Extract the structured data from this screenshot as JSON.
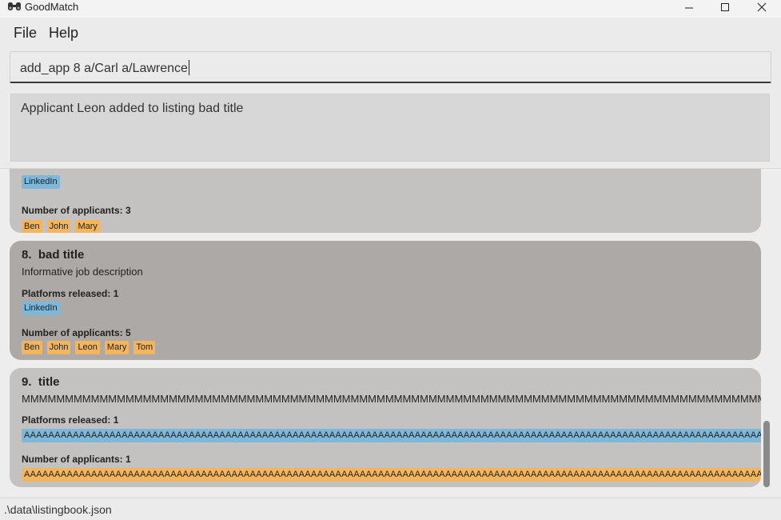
{
  "window": {
    "title": "GoodMatch",
    "icon": "binoculars-icon",
    "controls": [
      "minimize-icon",
      "maximize-icon",
      "close-icon"
    ]
  },
  "menu": {
    "file": "File",
    "help": "Help"
  },
  "command": {
    "value": "add_app 8 a/Carl a/Lawrence"
  },
  "result": {
    "text": "Applicant Leon added to listing bad title"
  },
  "listings": {
    "partial": {
      "platforms": [
        "LinkedIn"
      ],
      "applicants_label": "Number of applicants: 3",
      "applicants": [
        "Ben",
        "John",
        "Mary"
      ]
    },
    "item8": {
      "index": "8.",
      "title": "bad title",
      "description": "Informative job description",
      "platforms_label": "Platforms released: 1",
      "platforms": [
        "LinkedIn"
      ],
      "applicants_label": "Number of applicants: 5",
      "applicants": [
        "Ben",
        "John",
        "Leon",
        "Mary",
        "Tom"
      ]
    },
    "item9": {
      "index": "9.",
      "title": "title",
      "description": "MMMMMMMMMMMMMMMMMMMMMMMMMMMMMMMMMMMMMMMMMMMMMMMMMMMMMMMMMMMMMMMMMMMMMMMMMMMMMMMMMMMMMMMMMM",
      "platforms_label": "Platforms released: 1",
      "platform": "AAAAAAAAAAAAAAAAAAAAAAAAAAAAAAAAAAAAAAAAAAAAAAAAAAAAAAAAAAAAAAAAAAAAAAAAAAAAAAAAAAAAAAAAAAAAAAAAAAAAAAAAAAAAAAAAAAAAAAAAAAAAAAAAAAAAAAAAAAAAAA",
      "applicants_label": "Number of applicants: 1",
      "applicant": "AAAAAAAAAAAAAAAAAAAAAAAAAAAAAAAAAAAAAAAAAAAAAAAAAAAAAAAAAAAAAAAAAAAAAAAAAAAAAAAAAAAAAAAAAAAAAAAAAAAAAAAAAAAAAAAAAAAAAAAAAAAAAAAAAAAAAAAAAAAAAA"
    }
  },
  "status": {
    "path": ".\\data\\listingbook.json"
  },
  "colors": {
    "platform_tag": "#7db8da",
    "applicant_tag": "#f4b55d",
    "card_even": "#c4c2c1",
    "card_odd": "#ada9a6"
  }
}
